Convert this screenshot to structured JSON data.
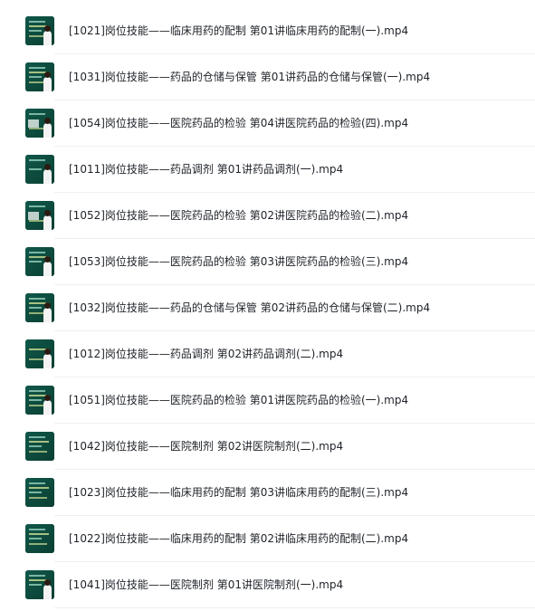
{
  "files": [
    {
      "name": "[1021]岗位技能——临床用药的配制 第01讲临床用药的配制(一).mp4",
      "thumbnail_icon": "video-thumbnail-icon"
    },
    {
      "name": "[1031]岗位技能——药品的仓储与保管 第01讲药品的仓储与保管(一).mp4",
      "thumbnail_icon": "video-thumbnail-icon"
    },
    {
      "name": "[1054]岗位技能——医院药品的检验 第04讲医院药品的检验(四).mp4",
      "thumbnail_icon": "video-thumbnail-icon"
    },
    {
      "name": "[1011]岗位技能——药品调剂 第01讲药品调剂(一).mp4",
      "thumbnail_icon": "video-thumbnail-icon"
    },
    {
      "name": "[1052]岗位技能——医院药品的检验 第02讲医院药品的检验(二).mp4",
      "thumbnail_icon": "video-thumbnail-icon"
    },
    {
      "name": "[1053]岗位技能——医院药品的检验 第03讲医院药品的检验(三).mp4",
      "thumbnail_icon": "video-thumbnail-icon"
    },
    {
      "name": "[1032]岗位技能——药品的仓储与保管 第02讲药品的仓储与保管(二).mp4",
      "thumbnail_icon": "video-thumbnail-icon"
    },
    {
      "name": "[1012]岗位技能——药品调剂 第02讲药品调剂(二).mp4",
      "thumbnail_icon": "video-thumbnail-icon"
    },
    {
      "name": "[1051]岗位技能——医院药品的检验 第01讲医院药品的检验(一).mp4",
      "thumbnail_icon": "video-thumbnail-icon"
    },
    {
      "name": "[1042]岗位技能——医院制剂 第02讲医院制剂(二).mp4",
      "thumbnail_icon": "video-thumbnail-icon"
    },
    {
      "name": "[1023]岗位技能——临床用药的配制 第03讲临床用药的配制(三).mp4",
      "thumbnail_icon": "video-thumbnail-icon"
    },
    {
      "name": "[1022]岗位技能——临床用药的配制 第02讲临床用药的配制(二).mp4",
      "thumbnail_icon": "video-thumbnail-icon"
    },
    {
      "name": "[1041]岗位技能——医院制剂 第01讲医院制剂(一).mp4",
      "thumbnail_icon": "video-thumbnail-icon"
    }
  ]
}
